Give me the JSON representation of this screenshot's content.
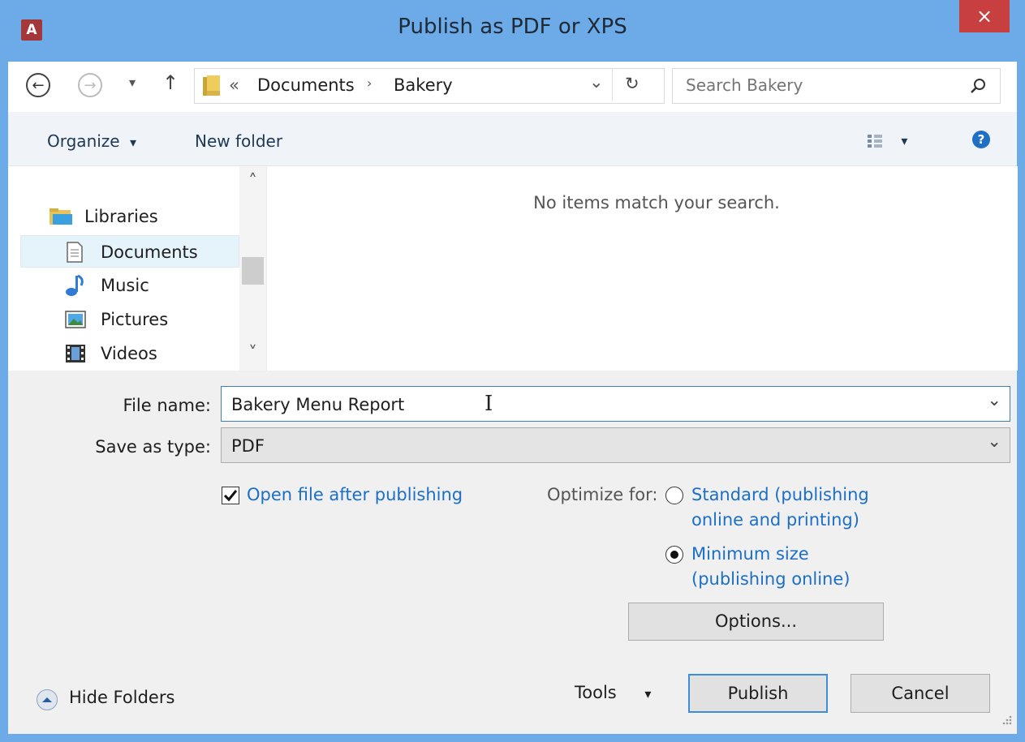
{
  "window": {
    "title": "Publish as PDF or XPS",
    "app_icon": "access-icon",
    "close_glyph": "×"
  },
  "navigation": {
    "back_glyph": "←",
    "forward_glyph": "→",
    "recent_glyph": "▾",
    "up_glyph": "↑",
    "address": {
      "overflow": "«",
      "crumbs": [
        "Documents",
        "Bakery"
      ],
      "separator": "›",
      "dropdown_glyph": "⌄",
      "refresh_glyph": "↻"
    },
    "search": {
      "placeholder": "Search Bakery"
    }
  },
  "toolbar": {
    "organize": "Organize",
    "caret": "▾",
    "new_folder": "New folder",
    "help": "?"
  },
  "nav_pane": {
    "items": [
      {
        "label": "Libraries",
        "icon": "libraries-icon"
      },
      {
        "label": "Documents",
        "icon": "documents-icon",
        "selected": true
      },
      {
        "label": "Music",
        "icon": "music-icon"
      },
      {
        "label": "Pictures",
        "icon": "pictures-icon"
      },
      {
        "label": "Videos",
        "icon": "videos-icon"
      }
    ],
    "scroll_up": "˄",
    "scroll_down": "˅"
  },
  "file_list": {
    "empty_message": "No items match your search."
  },
  "form": {
    "file_name_label": "File name:",
    "file_name_value": "Bakery Menu Report",
    "save_type_label": "Save as type:",
    "save_type_value": "PDF",
    "dropdown_glyph": "⌄",
    "checkbox_label": "Open file after publishing",
    "checkbox_checked": true,
    "optimize_label": "Optimize for:",
    "radio_standard_line1": "Standard (publishing",
    "radio_standard_line2": "online and printing)",
    "radio_minimum_line1": "Minimum size",
    "radio_minimum_line2": "(publishing online)",
    "selected_option": "minimum",
    "options_button": "Options..."
  },
  "footer": {
    "hide_folders": "Hide Folders",
    "tools": "Tools",
    "tools_caret": "▾",
    "publish": "Publish",
    "cancel": "Cancel"
  },
  "colors": {
    "title_bar": "#6cabe8",
    "close": "#c7403f",
    "link": "#1c6fc7",
    "selection": "#e5f3fb"
  }
}
